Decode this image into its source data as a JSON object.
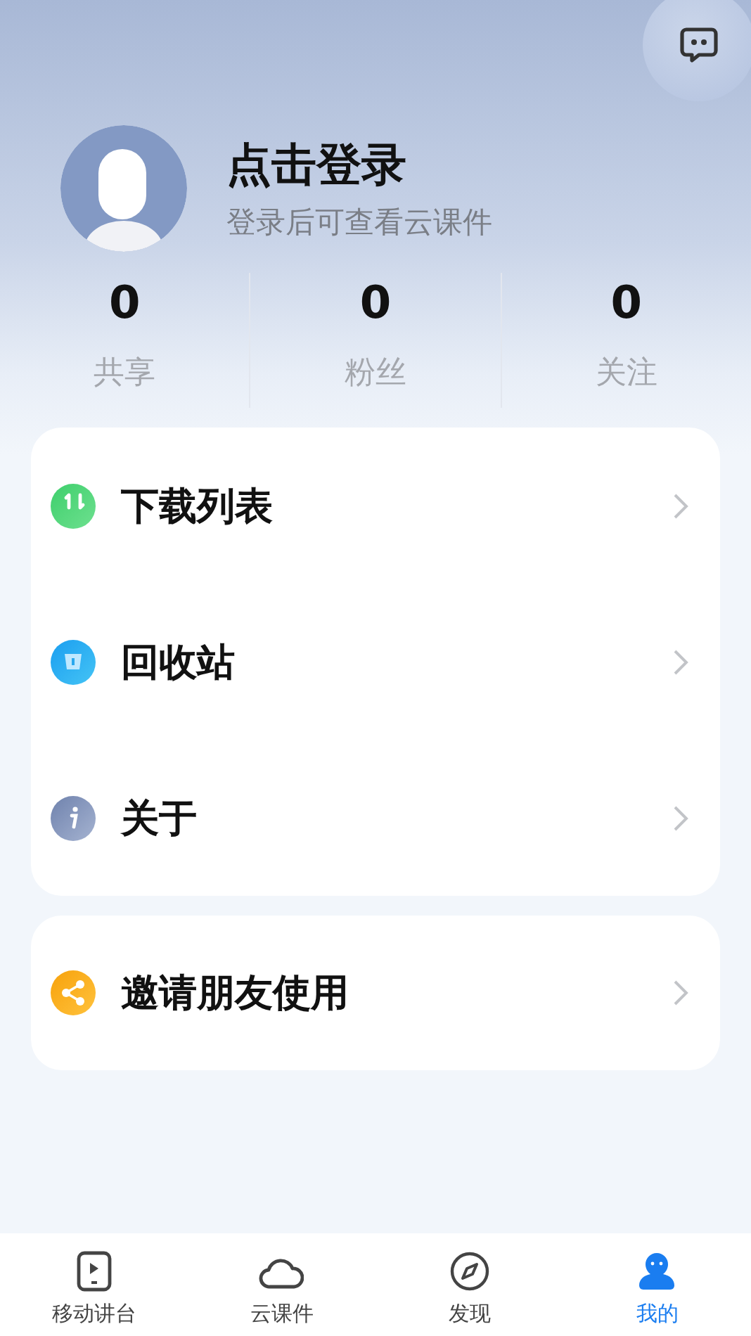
{
  "profile": {
    "title": "点击登录",
    "subtitle": "登录后可查看云课件"
  },
  "stats": [
    {
      "value": "0",
      "label": "共享"
    },
    {
      "value": "0",
      "label": "粉丝"
    },
    {
      "value": "0",
      "label": "关注"
    }
  ],
  "menu_groups": [
    [
      {
        "kind": "download",
        "label": "下载列表"
      },
      {
        "kind": "trash",
        "label": "回收站"
      },
      {
        "kind": "info",
        "label": "关于"
      }
    ],
    [
      {
        "kind": "share",
        "label": "邀请朋友使用"
      }
    ]
  ],
  "tab_bar": [
    {
      "kind": "player",
      "label": "移动讲台",
      "selected": false
    },
    {
      "kind": "cloud",
      "label": "云课件",
      "selected": false
    },
    {
      "kind": "compass",
      "label": "发现",
      "selected": false
    },
    {
      "kind": "person",
      "label": "我的",
      "selected": true
    }
  ]
}
